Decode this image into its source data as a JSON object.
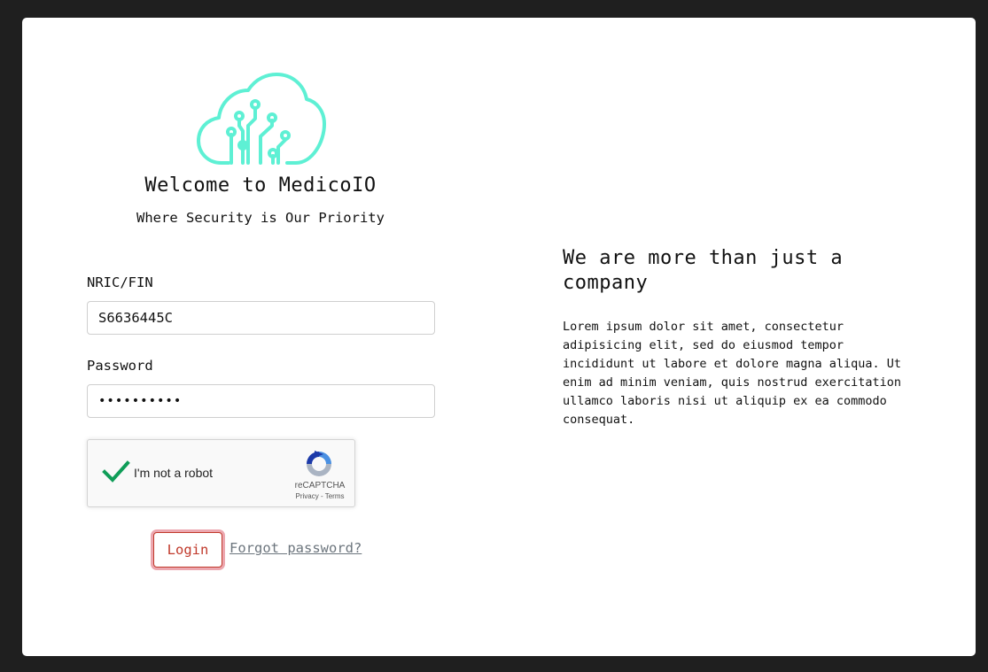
{
  "brand": {
    "logo_icon": "cloud-circuit-icon",
    "logo_color": "#5ef0d4",
    "welcome": "Welcome to MedicoIO",
    "tagline": "Where Security is Our Priority"
  },
  "form": {
    "nric_label": "NRIC/FIN",
    "nric_value": "S6636445C",
    "password_label": "Password",
    "password_value": "••••••••••",
    "captcha": {
      "label": "I'm not a robot",
      "checked": true,
      "brand": "reCAPTCHA",
      "links": "Privacy - Terms"
    },
    "login_label": "Login",
    "forgot_label": "Forgot password?"
  },
  "info": {
    "heading": "We are more than just a company",
    "body": "Lorem ipsum dolor sit amet, consectetur adipisicing elit, sed do eiusmod tempor incididunt ut labore et dolore magna aliqua. Ut enim ad minim veniam, quis nostrud exercitation ullamco laboris nisi ut aliquip ex ea commodo consequat."
  },
  "colors": {
    "accent": "#5ef0d4",
    "login": "#c0392b",
    "background": "#1f1f1f"
  }
}
